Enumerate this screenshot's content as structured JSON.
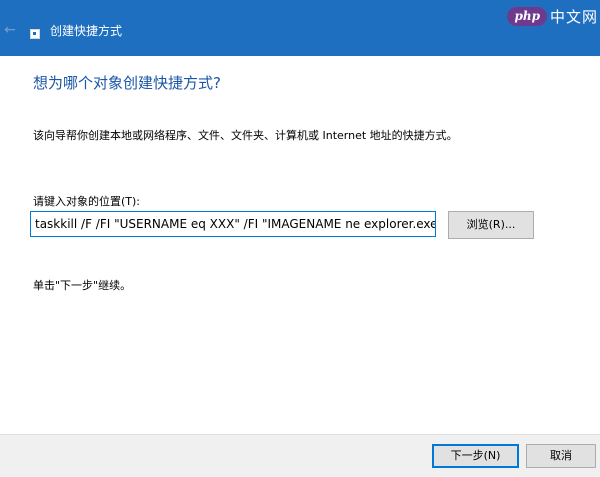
{
  "titlebar": {
    "title": "创建快捷方式",
    "back_icon": "←",
    "logo_php": "php",
    "logo_cn": "中文网"
  },
  "main": {
    "heading": "想为哪个对象创建快捷方式?",
    "description": "该向导帮你创建本地或网络程序、文件、文件夹、计算机或 Internet 地址的快捷方式。",
    "field_label": "请键入对象的位置(T):",
    "target_value": "taskkill /F /FI \"USERNAME eq XXX\" /FI \"IMAGENAME ne explorer.exe",
    "browse_label": "浏览(R)...",
    "hint": "单击\"下一步\"继续。"
  },
  "footer": {
    "next_label": "下一步(N)",
    "cancel_label": "取消"
  },
  "colors": {
    "titlebar": "#1f6fc1",
    "heading": "#1a56a8",
    "focus_border": "#0078d7"
  }
}
